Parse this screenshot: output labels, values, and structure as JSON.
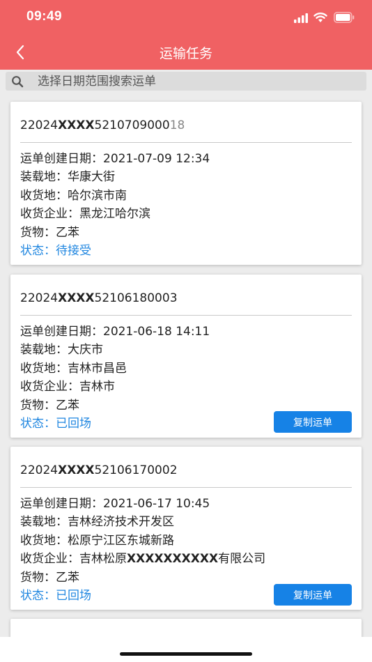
{
  "status_bar": {
    "time": "09:49"
  },
  "nav": {
    "title": "运输任务"
  },
  "search": {
    "placeholder": "选择日期范围搜索运单"
  },
  "labels": {
    "created": "运单创建日期：",
    "loading": "装载地：",
    "receiving": "收货地：",
    "company": "收货企业：",
    "goods": "货物：",
    "status": "状态："
  },
  "orders": [
    {
      "no_prefix": "22024",
      "no_mask": "XXXX",
      "no_suffix": "5210709000",
      "no_fade": "18",
      "created": "2021-07-09 12:34",
      "loading": "华康大街",
      "receiving": "哈尔滨市南",
      "company": "黑龙江哈尔滨",
      "goods": "乙苯",
      "status": "待接受"
    },
    {
      "no_prefix": "22024",
      "no_mask": "XXXX",
      "no_suffix": "52106180003",
      "no_fade": "",
      "created": "2021-06-18 14:11",
      "loading": "大庆市",
      "receiving": "吉林市昌邑",
      "company": "吉林市",
      "goods": "乙苯",
      "status": "已回场",
      "button": "复制运单"
    },
    {
      "no_prefix": "22024",
      "no_mask": "XXXX",
      "no_suffix": "52106170002",
      "no_fade": "",
      "created": "2021-06-17 10:45",
      "loading": "吉林经济技术开发区",
      "receiving": "松原宁江区东城新路",
      "company_prefix": "吉林松原",
      "company_mask": "XXXXXXXXXX",
      "company_suffix": "有限公司",
      "goods": "乙苯",
      "status": "已回场",
      "button": "复制运单"
    }
  ],
  "colors": {
    "header": "#f06163",
    "status_blue": "#1f86e0",
    "button_blue": "#1682e6"
  }
}
